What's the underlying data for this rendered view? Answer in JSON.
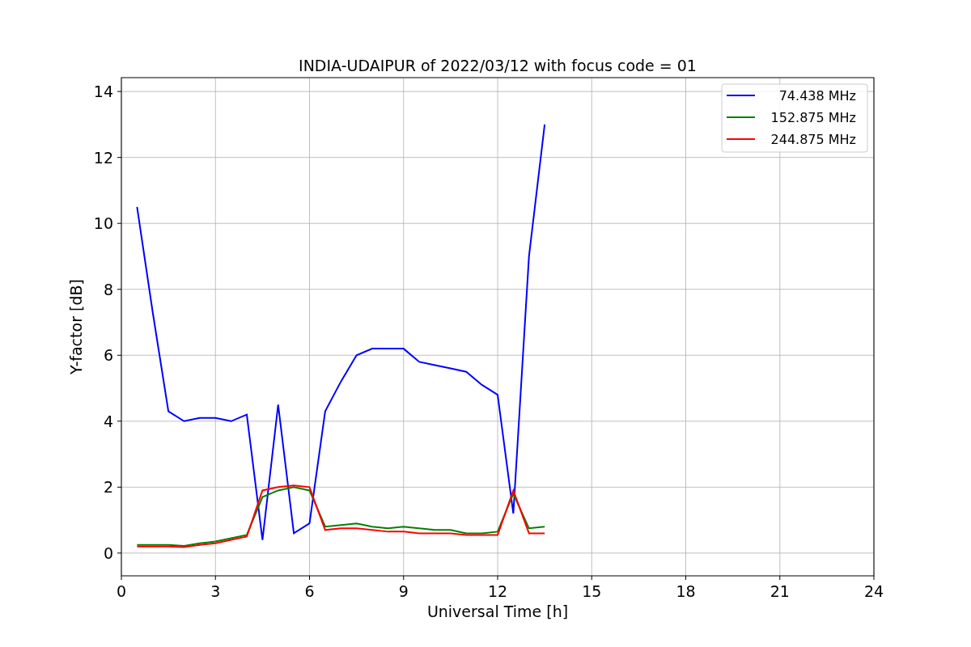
{
  "figure": {
    "chart_data": {
      "type": "line",
      "title": "INDIA-UDAIPUR of 2022/03/12 with focus code = 01",
      "xlabel": "Universal Time [h]",
      "ylabel": "Y-factor [dB]",
      "x": [
        0.5,
        1,
        1.5,
        2,
        2.5,
        3,
        3.5,
        4,
        4.5,
        5,
        5.5,
        6,
        6.5,
        7,
        7.5,
        8,
        8.5,
        9,
        9.5,
        10,
        10.5,
        11,
        11.5,
        12,
        12.5,
        13,
        13.5
      ],
      "series": [
        {
          "name": "74.438 MHz",
          "color": "#0000ff",
          "values": [
            10.5,
            7.3,
            4.3,
            4.0,
            4.1,
            4.1,
            4.0,
            4.2,
            0.4,
            4.5,
            0.6,
            0.9,
            4.3,
            5.2,
            6.0,
            6.2,
            6.2,
            6.2,
            5.8,
            5.7,
            5.6,
            5.5,
            5.1,
            4.8,
            1.2,
            9.0,
            13.0
          ]
        },
        {
          "name": "152.875 MHz",
          "color": "#008000",
          "values": [
            0.25,
            0.25,
            0.25,
            0.22,
            0.3,
            0.35,
            0.45,
            0.55,
            1.7,
            1.9,
            2.0,
            1.9,
            0.8,
            0.85,
            0.9,
            0.8,
            0.75,
            0.8,
            0.75,
            0.7,
            0.7,
            0.6,
            0.6,
            0.65,
            1.8,
            0.75,
            0.8
          ]
        },
        {
          "name": "244.875 MHz",
          "color": "#ff0000",
          "values": [
            0.2,
            0.2,
            0.2,
            0.18,
            0.25,
            0.3,
            0.4,
            0.5,
            1.9,
            2.0,
            2.05,
            2.0,
            0.7,
            0.75,
            0.75,
            0.7,
            0.65,
            0.65,
            0.6,
            0.6,
            0.6,
            0.55,
            0.55,
            0.55,
            1.9,
            0.6,
            0.6
          ]
        }
      ],
      "xlim": [
        0,
        24
      ],
      "ylim": [
        -0.69,
        14.42
      ],
      "xticks": [
        0,
        3,
        6,
        9,
        12,
        15,
        18,
        21,
        24
      ],
      "yticks": [
        0,
        2,
        4,
        6,
        8,
        10,
        12,
        14
      ],
      "grid": true,
      "legend": true
    }
  }
}
